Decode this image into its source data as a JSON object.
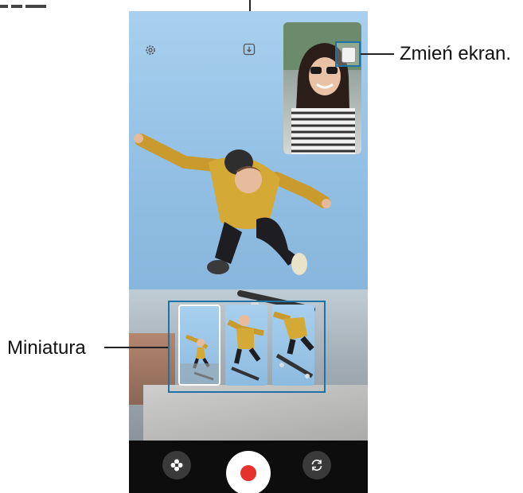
{
  "callouts": {
    "switch_screen": "Zmień ekran.",
    "thumbnail": "Miniatura"
  },
  "icons": {
    "settings": "gear-icon",
    "download": "download-icon",
    "pip_switch": "switch-screen-icon",
    "filter": "flower-icon",
    "record": "record-icon",
    "flip": "camera-flip-icon"
  },
  "colors": {
    "callout_border": "#1d73a6",
    "record_red": "#e5322d",
    "bottom_bar": "#0d0d0d"
  }
}
